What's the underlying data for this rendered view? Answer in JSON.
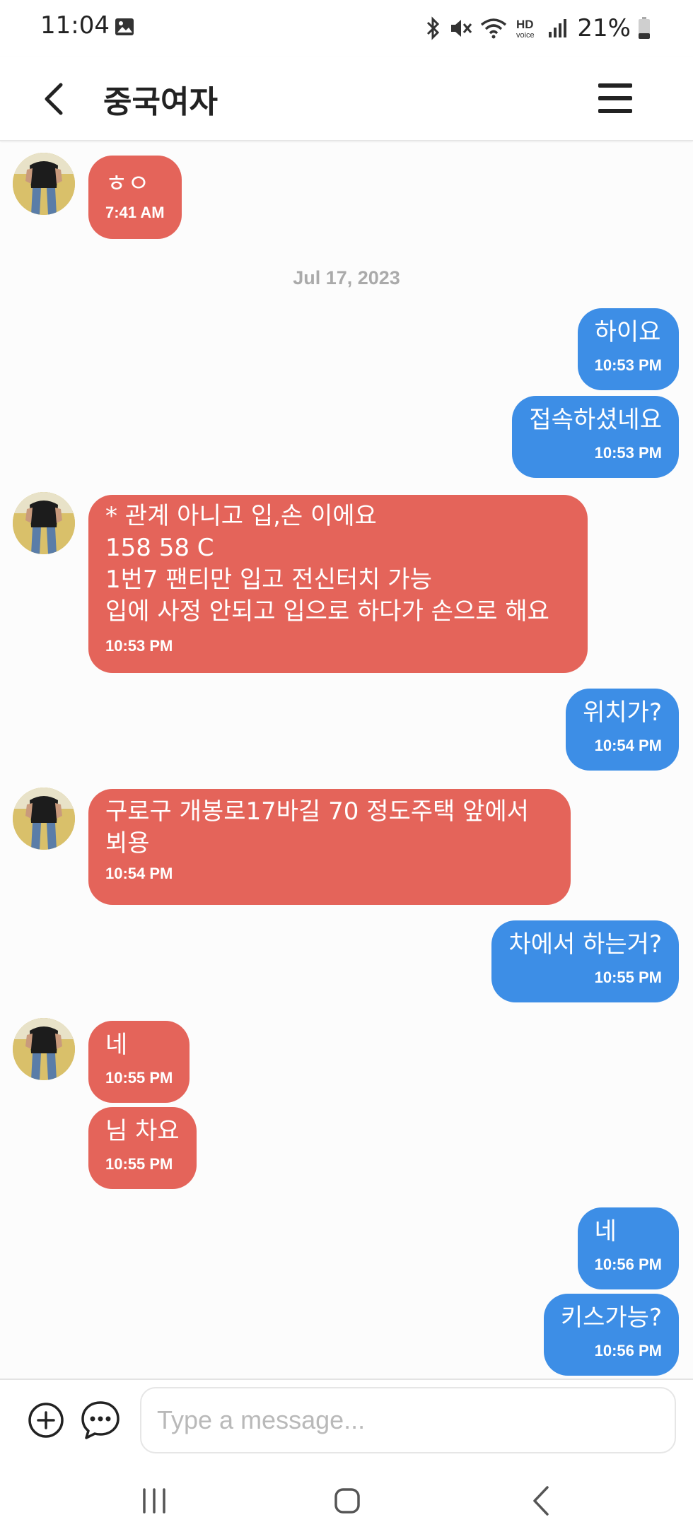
{
  "status_bar": {
    "time": "11:04",
    "battery": "21%",
    "icons": [
      "image-icon",
      "bluetooth-icon",
      "mute-icon",
      "wifi-icon",
      "hd-voice-icon",
      "signal-icon",
      "battery-icon"
    ]
  },
  "header": {
    "title": "중국여자",
    "back_icon": "chevron-left-icon",
    "menu_icon": "hamburger-menu-icon"
  },
  "chat": {
    "date_separator": "Jul 17, 2023",
    "messages": [
      {
        "dir": "in",
        "text": "ㅎㅇ",
        "time": "7:41 AM"
      },
      {
        "dir": "out",
        "text": "하이요",
        "time": "10:53 PM"
      },
      {
        "dir": "out",
        "text": "접속하셨네요",
        "time": "10:53 PM"
      },
      {
        "dir": "in",
        "text": "* 관계 아니고 입,손 이에요\n158 58 C\n1번7   팬티만 입고 전신터치 가능\n입에 사정 안되고 입으로 하다가 손으로 해요",
        "time": "10:53 PM"
      },
      {
        "dir": "out",
        "text": "위치가?",
        "time": "10:54 PM"
      },
      {
        "dir": "in",
        "text": "구로구 개봉로17바길 70 정도주택 앞에서\n뵈용",
        "time": "10:54 PM"
      },
      {
        "dir": "out",
        "text": "차에서 하는거?",
        "time": "10:55 PM"
      },
      {
        "dir": "in",
        "text": "네",
        "time": "10:55 PM"
      },
      {
        "dir": "in",
        "text": "님 차요",
        "time": "10:55 PM"
      },
      {
        "dir": "out",
        "text": "네",
        "time": "10:56 PM"
      },
      {
        "dir": "out",
        "text": "키스가능?",
        "time": "10:56 PM"
      }
    ]
  },
  "composer": {
    "placeholder": "Type a message...",
    "value": "",
    "add_icon": "plus-circle-icon",
    "emoji_icon": "chat-bubble-icon"
  },
  "nav_bar": {
    "icons": [
      "recent-apps-icon",
      "home-icon",
      "back-icon"
    ]
  },
  "colors": {
    "incoming_bubble": "#e4645a",
    "outgoing_bubble": "#3d8ee6",
    "date_text": "#aaaaaa"
  }
}
